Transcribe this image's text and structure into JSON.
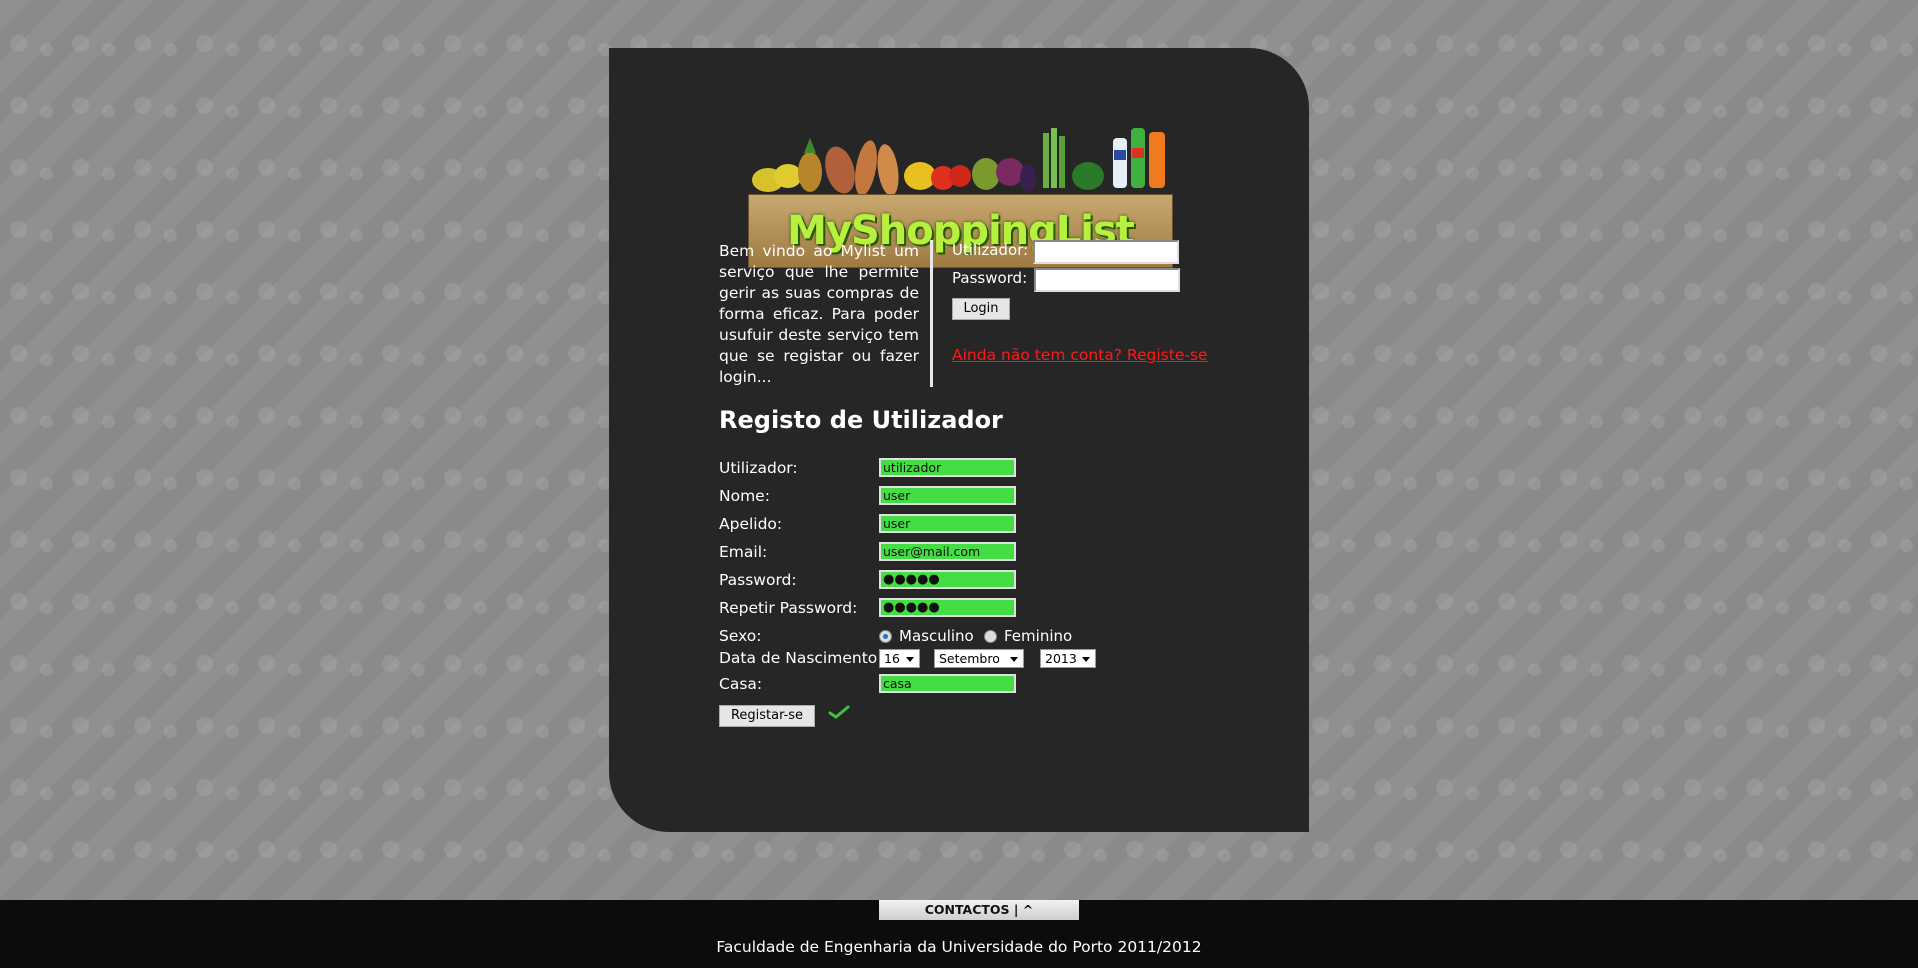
{
  "logo": {
    "text": "MyShoppingList"
  },
  "intro": {
    "text": "Bem vindo ao Mylist um serviço que lhe permite gerir as suas compras de forma eficaz. Para poder usufuir deste serviço tem que se registar ou fazer login..."
  },
  "login": {
    "user_label": "Utilizador:",
    "password_label": "Password:",
    "user_value": "",
    "password_value": "",
    "button": "Login",
    "register_link": "Ainda não tem conta? Registe-se"
  },
  "register": {
    "heading": "Registo de Utilizador",
    "fields": [
      {
        "label": "Utilizador:",
        "value": "utilizador"
      },
      {
        "label": "Nome:",
        "value": "user"
      },
      {
        "label": "Apelido:",
        "value": "user"
      },
      {
        "label": "Email:",
        "value": "user@mail.com"
      },
      {
        "label": "Password:",
        "value": "●●●●●"
      },
      {
        "label": "Repetir Password:",
        "value": "●●●●●"
      }
    ],
    "sexo_label": "Sexo:",
    "sexo_options": [
      "Masculino",
      "Feminino"
    ],
    "sexo_selected": "Masculino",
    "birth_label": "Data de Nascimento:",
    "birth_day": "16",
    "birth_month": "Setembro",
    "birth_year": "2013",
    "casa_label": "Casa:",
    "casa_value": "casa",
    "submit": "Registar-se",
    "valid_icon": "checkmark-icon",
    "field_color": "#44dd44"
  },
  "footer": {
    "contacts": "CONTACTOS | ^",
    "credits": "Faculdade de Engenharia da Universidade do Porto 2011/2012"
  }
}
